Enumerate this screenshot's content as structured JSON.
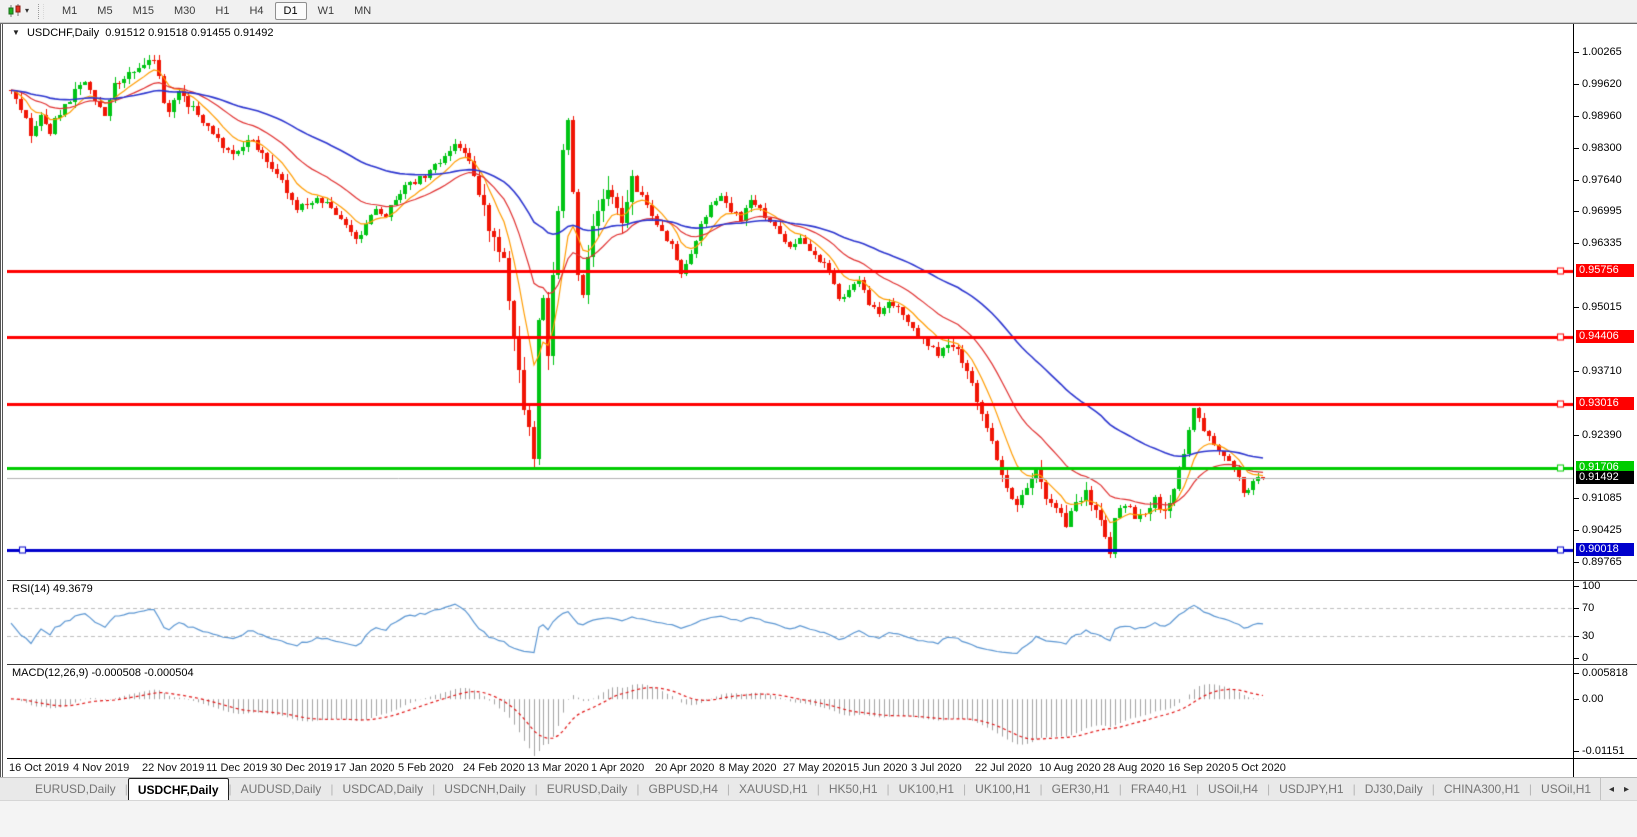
{
  "toolbar": {
    "chart_type_icon": "candlestick-chart-icon",
    "dropdown_caret": "▾",
    "timeframes": [
      "M1",
      "M5",
      "M15",
      "M30",
      "H1",
      "H4",
      "D1",
      "W1",
      "MN"
    ],
    "active_timeframe": "D1"
  },
  "header": {
    "collapse_arrow": "▼",
    "symbol": "USDCHF,Daily",
    "open": "0.91512",
    "high": "0.91518",
    "low": "0.91455",
    "close": "0.91492"
  },
  "indicators": {
    "rsi": {
      "label": "RSI(14) 49.3679",
      "period": 14,
      "value": 49.3679,
      "line_color": "#5b96d2",
      "axis_labels": [
        {
          "text": "100",
          "value": 100
        },
        {
          "text": "70",
          "value": 70
        },
        {
          "text": "30",
          "value": 30
        },
        {
          "text": "0",
          "value": 0
        }
      ],
      "level_lines": [
        70,
        30
      ]
    },
    "macd": {
      "label": "MACD(12,26,9) -0.000508 -0.000504",
      "main": -0.000508,
      "signal": -0.000504,
      "histogram_color": "#a3a3a3",
      "signal_color": "#e01515",
      "axis_labels": [
        {
          "text": "0.005818",
          "value": 0.005818
        },
        {
          "text": "0.00",
          "value": 0
        },
        {
          "text": "-0.01151",
          "value": -0.01151
        }
      ]
    }
  },
  "chart_data": {
    "type": "candlestick",
    "symbol": "USDCHF",
    "timeframe": "Daily",
    "ohlc_last": {
      "open": 0.91512,
      "high": 0.91518,
      "low": 0.91455,
      "close": 0.91492
    },
    "candle_up_color": "#00c414",
    "candle_down_color": "#f01505",
    "y_axis_ticks": [
      "1.00265",
      "0.99620",
      "0.98960",
      "0.98300",
      "0.97640",
      "0.96995",
      "0.96335",
      "0.95015",
      "0.93710",
      "0.92390",
      "0.91085",
      "0.90425",
      "0.89765"
    ],
    "x_axis_ticks": [
      {
        "label": "16 Oct 2019",
        "day": 0
      },
      {
        "label": "4 Nov 2019",
        "day": 13
      },
      {
        "label": "22 Nov 2019",
        "day": 27
      },
      {
        "label": "11 Dec 2019",
        "day": 40
      },
      {
        "label": "30 Dec 2019",
        "day": 53
      },
      {
        "label": "17 Jan 2020",
        "day": 66
      },
      {
        "label": "5 Feb 2020",
        "day": 79
      },
      {
        "label": "24 Feb 2020",
        "day": 92
      },
      {
        "label": "13 Mar 2020",
        "day": 105
      },
      {
        "label": "1 Apr 2020",
        "day": 118
      },
      {
        "label": "20 Apr 2020",
        "day": 131
      },
      {
        "label": "8 May 2020",
        "day": 144
      },
      {
        "label": "27 May 2020",
        "day": 157
      },
      {
        "label": "15 Jun 2020",
        "day": 170
      },
      {
        "label": "3 Jul 2020",
        "day": 183
      },
      {
        "label": "22 Jul 2020",
        "day": 196
      },
      {
        "label": "10 Aug 2020",
        "day": 209
      },
      {
        "label": "28 Aug 2020",
        "day": 222
      },
      {
        "label": "16 Sep 2020",
        "day": 235
      },
      {
        "label": "5 Oct 2020",
        "day": 248
      }
    ],
    "horizontal_lines": [
      {
        "price": 0.95756,
        "label": "0.95756",
        "color": "#ff0000",
        "width": 3,
        "role": "resistance"
      },
      {
        "price": 0.94406,
        "label": "0.94406",
        "color": "#ff0000",
        "width": 3,
        "role": "resistance"
      },
      {
        "price": 0.93016,
        "label": "0.93016",
        "color": "#ff0000",
        "width": 3,
        "role": "resistance"
      },
      {
        "price": 0.91706,
        "label": "0.91706",
        "color": "#00cc00",
        "width": 3,
        "role": "support"
      },
      {
        "price": 0.91492,
        "label": "0.91492",
        "color": "#b2b2b2",
        "width": 1,
        "role": "current-price",
        "box_color": "#000000"
      },
      {
        "price": 0.90018,
        "label": "0.90018",
        "color": "#0000cc",
        "width": 3,
        "role": "support"
      }
    ],
    "moving_averages": [
      {
        "name": "fast-ma",
        "period": 8,
        "color": "#ff9c00"
      },
      {
        "name": "medium-ma",
        "period": 21,
        "color": "#e03030"
      },
      {
        "name": "slow-ma",
        "period": 55,
        "color": "#2c35cf"
      }
    ],
    "candle_count": 255,
    "y_range": [
      0.8939,
      1.0085
    ],
    "close_anchors": [
      [
        0,
        0.995
      ],
      [
        2,
        0.9905
      ],
      [
        4,
        0.9862
      ],
      [
        6,
        0.99
      ],
      [
        8,
        0.9868
      ],
      [
        11,
        0.9915
      ],
      [
        13,
        0.995
      ],
      [
        15,
        0.9962
      ],
      [
        17,
        0.9925
      ],
      [
        19,
        0.99
      ],
      [
        21,
        0.9958
      ],
      [
        23,
        0.9975
      ],
      [
        25,
        0.9988
      ],
      [
        27,
        1.0
      ],
      [
        29,
        1.0018
      ],
      [
        30,
        0.9975
      ],
      [
        31,
        0.993
      ],
      [
        32,
        0.99
      ],
      [
        34,
        0.9942
      ],
      [
        36,
        0.992
      ],
      [
        38,
        0.99
      ],
      [
        40,
        0.987
      ],
      [
        42,
        0.9845
      ],
      [
        44,
        0.983
      ],
      [
        46,
        0.982
      ],
      [
        48,
        0.9845
      ],
      [
        50,
        0.9835
      ],
      [
        52,
        0.98
      ],
      [
        54,
        0.9775
      ],
      [
        56,
        0.974
      ],
      [
        58,
        0.97
      ],
      [
        60,
        0.9712
      ],
      [
        62,
        0.9728
      ],
      [
        64,
        0.9718
      ],
      [
        66,
        0.9695
      ],
      [
        68,
        0.9672
      ],
      [
        70,
        0.964
      ],
      [
        72,
        0.9672
      ],
      [
        74,
        0.97
      ],
      [
        76,
        0.9695
      ],
      [
        78,
        0.972
      ],
      [
        80,
        0.9748
      ],
      [
        82,
        0.976
      ],
      [
        84,
        0.9775
      ],
      [
        86,
        0.979
      ],
      [
        88,
        0.9812
      ],
      [
        90,
        0.9845
      ],
      [
        92,
        0.982
      ],
      [
        94,
        0.9775
      ],
      [
        96,
        0.97
      ],
      [
        98,
        0.9645
      ],
      [
        100,
        0.9585
      ],
      [
        101,
        0.952
      ],
      [
        102,
        0.943
      ],
      [
        103,
        0.936
      ],
      [
        104,
        0.931
      ],
      [
        105,
        0.9245
      ],
      [
        106,
        0.917
      ],
      [
        107,
        0.948
      ],
      [
        108,
        0.952
      ],
      [
        109,
        0.941
      ],
      [
        110,
        0.956
      ],
      [
        111,
        0.969
      ],
      [
        112,
        0.984
      ],
      [
        113,
        0.989
      ],
      [
        114,
        0.974
      ],
      [
        115,
        0.957
      ],
      [
        116,
        0.9525
      ],
      [
        117,
        0.96
      ],
      [
        118,
        0.966
      ],
      [
        120,
        0.974
      ],
      [
        122,
        0.9715
      ],
      [
        124,
        0.968
      ],
      [
        126,
        0.9755
      ],
      [
        128,
        0.973
      ],
      [
        130,
        0.9692
      ],
      [
        132,
        0.9662
      ],
      [
        134,
        0.9625
      ],
      [
        136,
        0.9565
      ],
      [
        138,
        0.9605
      ],
      [
        140,
        0.9672
      ],
      [
        142,
        0.9705
      ],
      [
        144,
        0.9725
      ],
      [
        146,
        0.97
      ],
      [
        148,
        0.9685
      ],
      [
        150,
        0.9718
      ],
      [
        152,
        0.97
      ],
      [
        154,
        0.9682
      ],
      [
        156,
        0.9655
      ],
      [
        158,
        0.9625
      ],
      [
        160,
        0.9645
      ],
      [
        162,
        0.9618
      ],
      [
        164,
        0.96
      ],
      [
        166,
        0.958
      ],
      [
        168,
        0.9512
      ],
      [
        170,
        0.953
      ],
      [
        172,
        0.9558
      ],
      [
        174,
        0.9512
      ],
      [
        176,
        0.9485
      ],
      [
        178,
        0.9518
      ],
      [
        180,
        0.9502
      ],
      [
        182,
        0.9465
      ],
      [
        184,
        0.9445
      ],
      [
        186,
        0.9422
      ],
      [
        188,
        0.9405
      ],
      [
        190,
        0.9432
      ],
      [
        192,
        0.9408
      ],
      [
        194,
        0.938
      ],
      [
        196,
        0.9312
      ],
      [
        198,
        0.9255
      ],
      [
        200,
        0.9182
      ],
      [
        202,
        0.9125
      ],
      [
        204,
        0.9098
      ],
      [
        206,
        0.913
      ],
      [
        208,
        0.9162
      ],
      [
        210,
        0.9115
      ],
      [
        212,
        0.9082
      ],
      [
        214,
        0.906
      ],
      [
        216,
        0.9092
      ],
      [
        218,
        0.9122
      ],
      [
        220,
        0.9082
      ],
      [
        222,
        0.903
      ],
      [
        223,
        0.8998
      ],
      [
        224,
        0.9062
      ],
      [
        226,
        0.9102
      ],
      [
        228,
        0.906
      ],
      [
        230,
        0.9082
      ],
      [
        232,
        0.9102
      ],
      [
        234,
        0.9088
      ],
      [
        236,
        0.9122
      ],
      [
        238,
        0.9205
      ],
      [
        240,
        0.9292
      ],
      [
        241,
        0.9268
      ],
      [
        242,
        0.9252
      ],
      [
        244,
        0.9222
      ],
      [
        246,
        0.9192
      ],
      [
        248,
        0.9172
      ],
      [
        250,
        0.912
      ],
      [
        252,
        0.9142
      ],
      [
        254,
        0.9149
      ]
    ]
  },
  "tabs": {
    "items": [
      "EURUSD,Daily",
      "USDCHF,Daily",
      "AUDUSD,Daily",
      "USDCAD,Daily",
      "USDCNH,Daily",
      "EURUSD,Daily",
      "GBPUSD,H4",
      "XAUUSD,H1",
      "HK50,H1",
      "UK100,H1",
      "UK100,H1",
      "GER30,H1",
      "FRA40,H1",
      "USOil,H4",
      "USDJPY,H1",
      "DJ30,Daily",
      "CHINA300,H1",
      "USOil,H1"
    ],
    "active_index": 1,
    "scroll_left_icon": "◂",
    "scroll_right_icon": "▸"
  }
}
